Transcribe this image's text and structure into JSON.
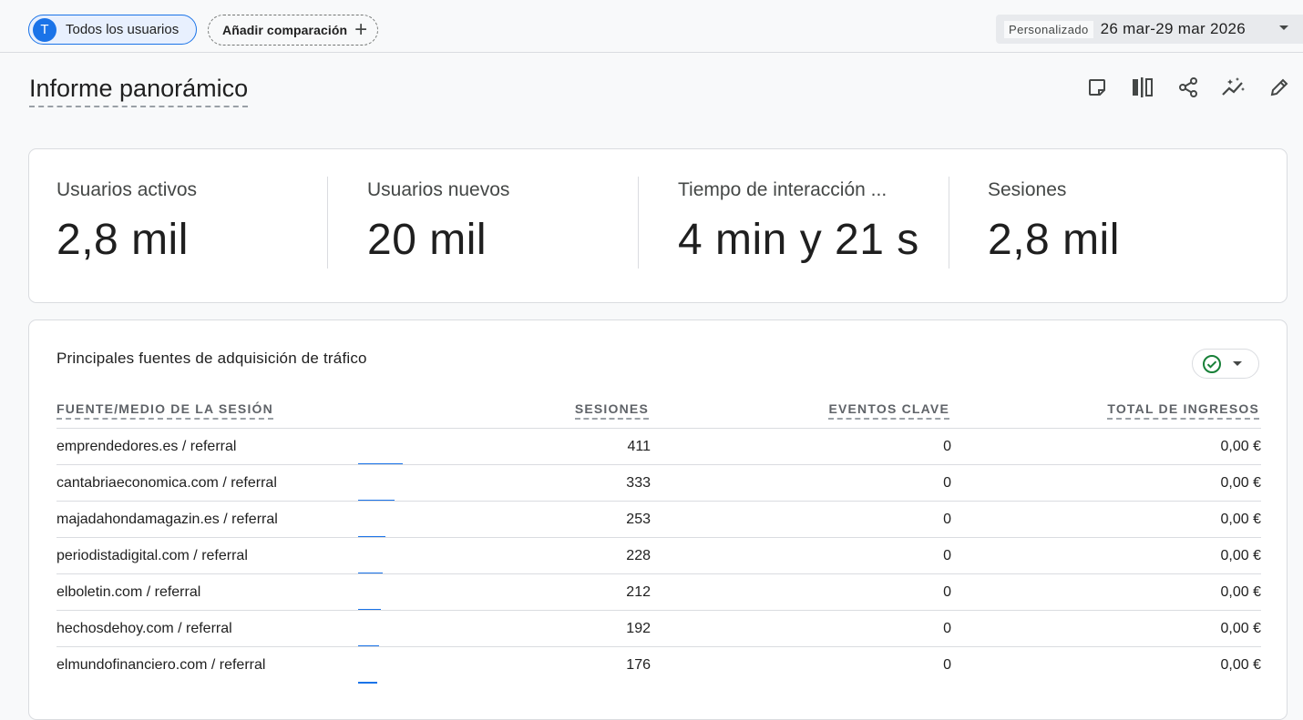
{
  "comparison_bar": {
    "all_users_avatar": "T",
    "all_users_label": "Todos los usuarios",
    "add_comparison_label": "Añadir comparación",
    "add_comparison_icon": "+"
  },
  "date_range": {
    "tag": "Personalizado",
    "range": "26 mar-29 mar 2026"
  },
  "page": {
    "title": "Informe panorámico",
    "toolbar_icons": [
      "note-icon",
      "compare-columns-icon",
      "share-icon",
      "insights-icon",
      "edit-icon"
    ]
  },
  "metrics": [
    {
      "label": "Usuarios activos",
      "value": "2,8 mil"
    },
    {
      "label": "Usuarios nuevos",
      "value": "20 mil"
    },
    {
      "label": "Tiempo de interacción ...",
      "value": "4 min y 21 s"
    },
    {
      "label": "Sesiones",
      "value": "2,8 mil"
    }
  ],
  "traffic_table": {
    "title": "Principales fuentes de adquisición de tráfico",
    "columns": [
      "FUENTE/MEDIO DE LA SESIÓN",
      "SESIONES",
      "EVENTOS CLAVE",
      "TOTAL DE INGRESOS"
    ],
    "rows": [
      {
        "source": "emprendedores.es / referral",
        "sessions": "411",
        "key_events": "0",
        "revenue": "0,00 €",
        "share": 1.0
      },
      {
        "source": "cantabriaeconomica.com / referral",
        "sessions": "333",
        "key_events": "0",
        "revenue": "0,00 €",
        "share": 0.81
      },
      {
        "source": "majadahondamagazin.es / referral",
        "sessions": "253",
        "key_events": "0",
        "revenue": "0,00 €",
        "share": 0.62
      },
      {
        "source": "periodistadigital.com / referral",
        "sessions": "228",
        "key_events": "0",
        "revenue": "0,00 €",
        "share": 0.55
      },
      {
        "source": "elboletin.com / referral",
        "sessions": "212",
        "key_events": "0",
        "revenue": "0,00 €",
        "share": 0.52
      },
      {
        "source": "hechosdehoy.com / referral",
        "sessions": "192",
        "key_events": "0",
        "revenue": "0,00 €",
        "share": 0.47
      },
      {
        "source": "elmundofinanciero.com / referral",
        "sessions": "176",
        "key_events": "0",
        "revenue": "0,00 €",
        "share": 0.43
      }
    ]
  },
  "colors": {
    "accent": "#1a73e8",
    "check_green": "#188038"
  }
}
